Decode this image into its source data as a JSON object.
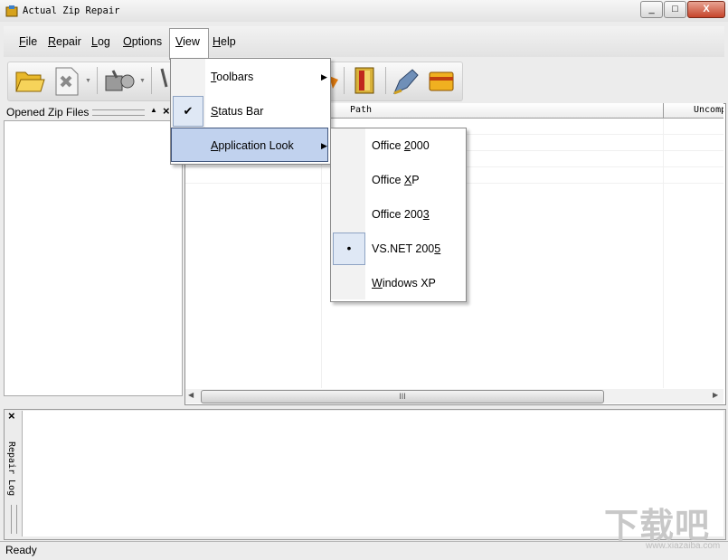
{
  "window": {
    "title": "Actual Zip Repair",
    "controls": [
      "_",
      "□",
      "X"
    ]
  },
  "menubar": {
    "file": {
      "mnemonic": "F",
      "rest": "ile"
    },
    "repair": {
      "mnemonic": "R",
      "rest": "epair"
    },
    "log": {
      "mnemonic": "L",
      "rest": "og"
    },
    "options": {
      "mnemonic": "O",
      "rest": "ptions"
    },
    "view": {
      "mnemonic": "V",
      "rest": "iew"
    },
    "help": {
      "mnemonic": "H",
      "rest": "elp"
    }
  },
  "view_menu": {
    "toolbars": {
      "mnemonic": "T",
      "rest": "oolbars"
    },
    "status_bar": {
      "mnemonic": "S",
      "rest": "tatus Bar",
      "checked": true
    },
    "application_look": {
      "mnemonic": "A",
      "rest": "pplication Look"
    }
  },
  "look_menu": {
    "office2000": {
      "before": "Office ",
      "mnemonic": "2",
      "after": "000"
    },
    "officexp": {
      "before": "Office ",
      "mnemonic": "X",
      "after": "P"
    },
    "office2003": {
      "before": "Office 200",
      "mnemonic": "3",
      "after": ""
    },
    "vsnet2005": {
      "before": "VS.NET 200",
      "mnemonic": "5",
      "after": "",
      "selected": true
    },
    "windowsxp": {
      "before": "",
      "mnemonic": "W",
      "after": "indows XP"
    }
  },
  "left_pane": {
    "title": "Opened Zip Files"
  },
  "list": {
    "columns": [
      "Path",
      "Uncomp"
    ]
  },
  "log_pane": {
    "tab_label": "Repair Log"
  },
  "status": {
    "text": "Ready"
  },
  "watermark": {
    "text": "下载吧",
    "url": "www.xiazaiba.com"
  },
  "colors": {
    "highlight": "#c1d2ee",
    "highlight_border": "#41567d",
    "frame": "#ececec"
  },
  "icons": [
    "open-folder-icon",
    "close-file-icon",
    "tools-icon",
    "book-icon",
    "edit-pen-icon",
    "card-icon"
  ]
}
